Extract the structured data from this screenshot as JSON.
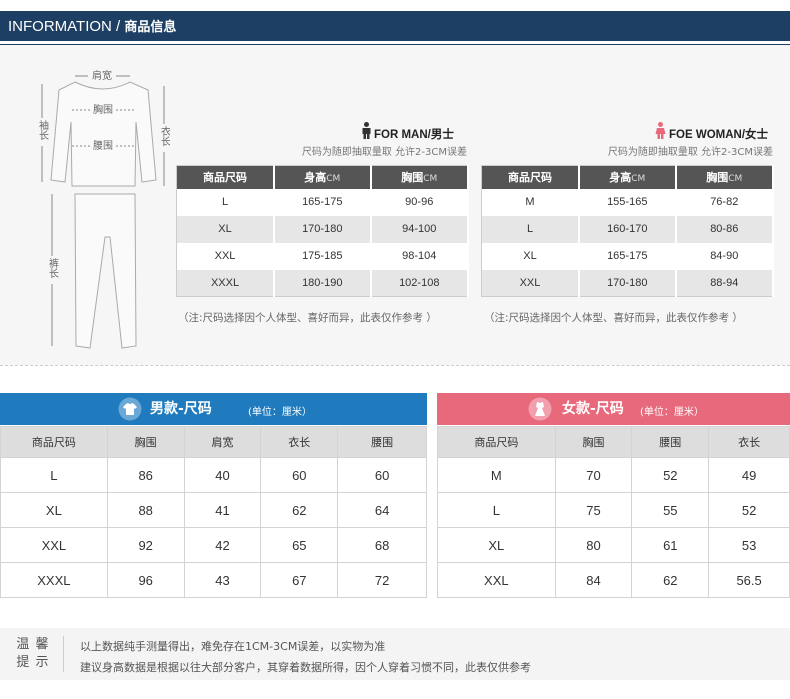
{
  "header": {
    "en": "INFORMATION / ",
    "zh": "商品信息"
  },
  "diagram": {
    "shoulder": "肩宽",
    "chest": "胸围",
    "waist": "腰围",
    "sleeve": "袖长",
    "body_length": "衣长",
    "pants_length": "裤长"
  },
  "men_top": {
    "title": "FOR MAN/男士",
    "subtitle": "尺码为随即抽取量取 允许2-3CM误差",
    "headers": [
      {
        "label": "商品尺码",
        "unit": ""
      },
      {
        "label": "身高",
        "unit": "CM"
      },
      {
        "label": "胸围",
        "unit": "CM"
      }
    ],
    "rows": [
      [
        "L",
        "165-175",
        "90-96"
      ],
      [
        "XL",
        "170-180",
        "94-100"
      ],
      [
        "XXL",
        "175-185",
        "98-104"
      ],
      [
        "XXXL",
        "180-190",
        "102-108"
      ]
    ],
    "note": "（注:尺码选择因个人体型、喜好而异，此表仅作参考 ）"
  },
  "women_top": {
    "title": "FOE WOMAN/女士",
    "subtitle": "尺码为随即抽取量取 允许2-3CM误差",
    "headers": [
      {
        "label": "商品尺码",
        "unit": ""
      },
      {
        "label": "身高",
        "unit": "CM"
      },
      {
        "label": "胸围",
        "unit": "CM"
      }
    ],
    "rows": [
      [
        "M",
        "155-165",
        "76-82"
      ],
      [
        "L",
        "160-170",
        "80-86"
      ],
      [
        "XL",
        "165-175",
        "84-90"
      ],
      [
        "XXL",
        "170-180",
        "88-94"
      ]
    ],
    "note": "（注:尺码选择因个人体型、喜好而异，此表仅作参考 ）"
  },
  "men_size": {
    "title": "男款-尺码",
    "unit": "(单位：厘米）",
    "headers": [
      "商品尺码",
      "胸围",
      "肩宽",
      "衣长",
      "腰围"
    ],
    "rows": [
      [
        "L",
        "86",
        "40",
        "60",
        "60"
      ],
      [
        "XL",
        "88",
        "41",
        "62",
        "64"
      ],
      [
        "XXL",
        "92",
        "42",
        "65",
        "68"
      ],
      [
        "XXXL",
        "96",
        "43",
        "67",
        "72"
      ]
    ]
  },
  "women_size": {
    "title": "女款-尺码",
    "unit": "(单位：厘米）",
    "headers": [
      "商品尺码",
      "胸围",
      "腰围",
      "衣长"
    ],
    "rows": [
      [
        "M",
        "70",
        "52",
        "49"
      ],
      [
        "L",
        "75",
        "55",
        "52"
      ],
      [
        "XL",
        "80",
        "61",
        "53"
      ],
      [
        "XXL",
        "84",
        "62",
        "56.5"
      ]
    ]
  },
  "tips": {
    "label_line1": "温 馨",
    "label_line2": "提 示",
    "line1": "以上数据纯手测量得出，难免存在1CM-3CM误差，以实物为准",
    "line2": "建议身高数据是根据以往大部分客户，其穿着数据所得，因个人穿着习惯不同，此表仅供参考"
  },
  "colors": {
    "header": "#1d3f63",
    "men": "#1f7bbd",
    "women": "#e8697c",
    "table_head": "#555555"
  }
}
